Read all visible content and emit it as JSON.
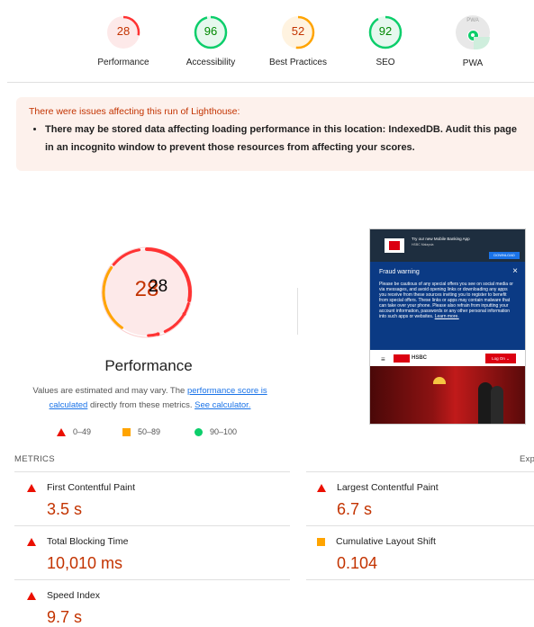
{
  "categories": [
    {
      "label": "Performance",
      "score": "28",
      "level": 0.28,
      "color": "#ff3333",
      "bg": "#fde9e9",
      "text": "#c33300"
    },
    {
      "label": "Accessibility",
      "score": "96",
      "level": 0.96,
      "color": "#0cce6b",
      "bg": "#e6f8ee",
      "text": "#008800"
    },
    {
      "label": "Best Practices",
      "score": "52",
      "level": 0.52,
      "color": "#ffa400",
      "bg": "#fff3e0",
      "text": "#c33300"
    },
    {
      "label": "SEO",
      "score": "92",
      "level": 0.92,
      "color": "#0cce6b",
      "bg": "#e6f8ee",
      "text": "#008800"
    },
    {
      "label": "PWA",
      "score": "",
      "level": 0,
      "color": "#9e9e9e",
      "bg": "#e8e8e8",
      "text": "#757575"
    }
  ],
  "pwa_badge_text": "PWA",
  "warning": {
    "title": "There were issues affecting this run of Lighthouse:",
    "item_line1": "There may be stored data affecting loading performance in this location: IndexedDB. Audit this page",
    "item_line2": "in an incognito window to prevent those resources from affecting your scores."
  },
  "performance": {
    "score": "28",
    "score_overlay": "28",
    "label": "Performance",
    "desc_prefix": "Values are estimated and may vary. The ",
    "desc_link1": "performance score is calculated",
    "desc_mid": " directly from these metrics. ",
    "desc_link2": "See calculator."
  },
  "legend": {
    "fail": "0–49",
    "average": "50–89",
    "pass": "90–100"
  },
  "thumbnail": {
    "banner_title": "Try our new Mobile Banking App",
    "banner_sub": "HSBC Malaysia",
    "download": "DOWNLOAD",
    "fraud_title": "Fraud warning",
    "fraud_close": "×",
    "fraud_text": "Please be cautious of any special offers you see on social media or via messages, and avoid opening links or downloading any apps you receive from these sources inviting you to register to benefit from special offers. These links or apps may contain malware that can take over your phone. Please also refrain from inputting your account information, passwords or any other personal information into such apps or websites.",
    "learn_more": "Learn more.",
    "brand": "HSBC",
    "logon": "Log On"
  },
  "metrics_header": "METRICS",
  "expand_label": "Exp",
  "metrics": [
    {
      "name": "First Contentful Paint",
      "value": "3.5 s",
      "rating": "fail"
    },
    {
      "name": "Largest Contentful Paint",
      "value": "6.7 s",
      "rating": "fail"
    },
    {
      "name": "Total Blocking Time",
      "value": "10,010 ms",
      "rating": "fail"
    },
    {
      "name": "Cumulative Layout Shift",
      "value": "0.104",
      "rating": "average"
    },
    {
      "name": "Speed Index",
      "value": "9.7 s",
      "rating": "fail"
    }
  ]
}
